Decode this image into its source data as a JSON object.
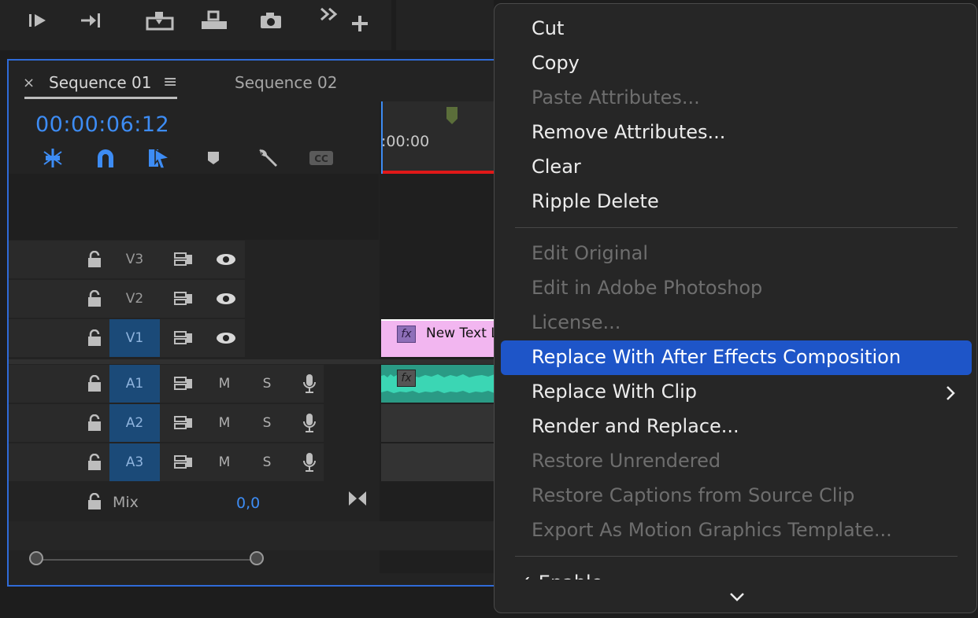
{
  "timeline": {
    "tabs": [
      {
        "label": "Sequence 01",
        "close": "×",
        "menu": "≡"
      },
      {
        "label": "Sequence 02"
      }
    ],
    "timecode": "00:00:06:12",
    "ruler_time": ":00:00",
    "video_tracks": [
      {
        "label": "V3",
        "targeted": false
      },
      {
        "label": "V2",
        "targeted": false
      },
      {
        "label": "V1",
        "targeted": true
      }
    ],
    "audio_tracks": [
      {
        "label": "A1",
        "m": "M",
        "s": "S"
      },
      {
        "label": "A2",
        "m": "M",
        "s": "S"
      },
      {
        "label": "A3",
        "m": "M",
        "s": "S"
      }
    ],
    "mix": {
      "label": "Mix",
      "value": "0,0"
    },
    "clips": {
      "title_clip": {
        "label": "New Text L",
        "fx": "fx",
        "color": "#f2b6f0"
      },
      "audio_clip": {
        "fx": "fx",
        "color": "#3bd6b4"
      }
    },
    "accent_color": "#3d8cf4"
  },
  "context_menu": {
    "items_a": [
      {
        "label": "Cut",
        "enabled": true
      },
      {
        "label": "Copy",
        "enabled": true
      },
      {
        "label": "Paste Attributes...",
        "enabled": false
      },
      {
        "label": "Remove Attributes...",
        "enabled": true
      },
      {
        "label": "Clear",
        "enabled": true
      },
      {
        "label": "Ripple Delete",
        "enabled": true
      }
    ],
    "items_b": [
      {
        "label": "Edit Original",
        "enabled": false
      },
      {
        "label": "Edit in Adobe Photoshop",
        "enabled": false
      },
      {
        "label": "License...",
        "enabled": false
      },
      {
        "label": "Replace With After Effects Composition",
        "enabled": true,
        "highlighted": true
      },
      {
        "label": "Replace With Clip",
        "enabled": true,
        "submenu": true
      },
      {
        "label": "Render and Replace...",
        "enabled": true
      },
      {
        "label": "Restore Unrendered",
        "enabled": false
      },
      {
        "label": "Restore Captions from Source Clip",
        "enabled": false
      },
      {
        "label": "Export As Motion Graphics Template...",
        "enabled": false
      }
    ],
    "items_c": [
      {
        "label": "✓ Enable",
        "enabled": true
      }
    ],
    "highlight_color": "#1e55c8"
  }
}
